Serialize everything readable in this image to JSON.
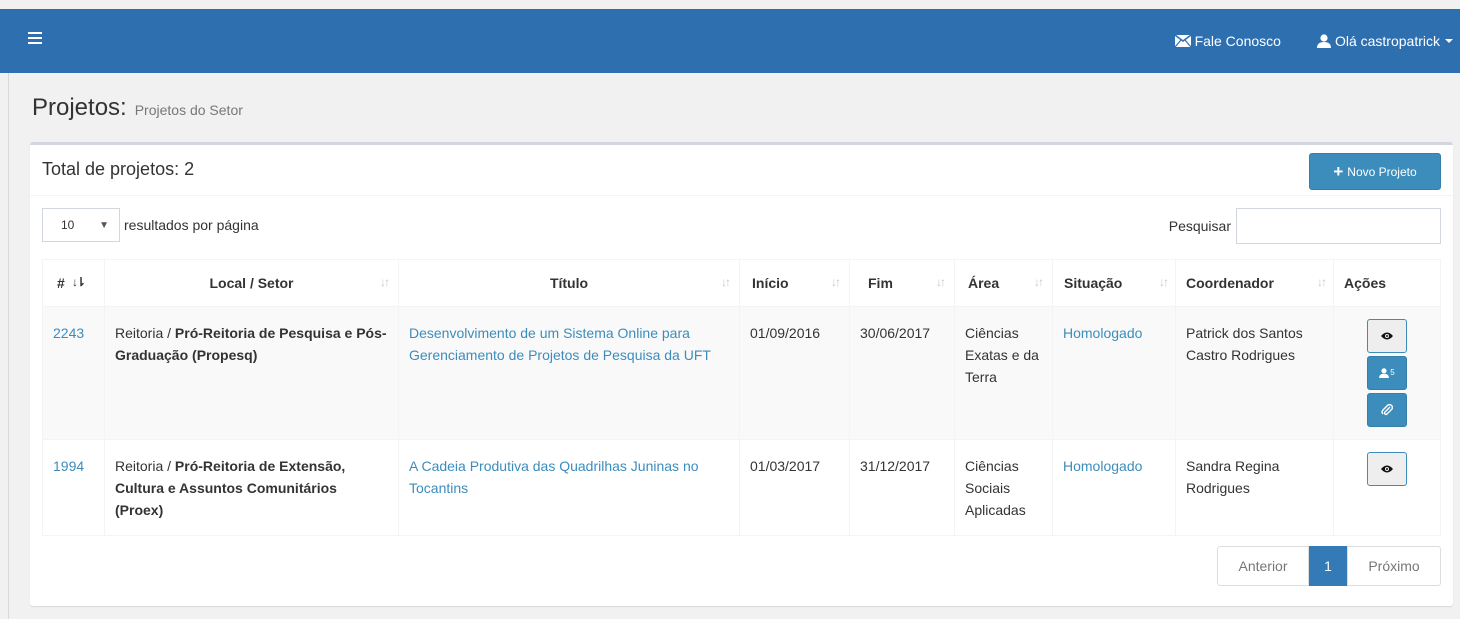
{
  "navbar": {
    "contact": "Fale Conosco",
    "user": "Olá castropatrick",
    "menu_icon": "hamburger-icon",
    "contact_icon": "envelope-icon",
    "user_icon": "user-icon",
    "color": "#2e6fb0"
  },
  "page": {
    "title": "Projetos:",
    "subtitle": "Projetos do Setor"
  },
  "box": {
    "total": "Total de projetos: 2",
    "new_button": "Novo Projeto"
  },
  "controls": {
    "page_size": "10",
    "page_size_label": "resultados por página",
    "search_label": "Pesquisar",
    "search_value": ""
  },
  "table": {
    "columns": [
      "#",
      "Local / Setor",
      "Título",
      "Início",
      "Fim",
      "Área",
      "Situação",
      "Coordenador",
      "Ações"
    ],
    "rows": [
      {
        "id": "2243",
        "local_prefix": "Reitoria / ",
        "local_bold": "Pró-Reitoria de Pesquisa e Pós-Graduação (Propesq)",
        "title": "Desenvolvimento de um Sistema Online para Gerenciamento de Projetos de Pesquisa da UFT",
        "start": "01/09/2016",
        "end": "30/06/2017",
        "area": "Ciências Exatas e da Terra",
        "status": "Homologado",
        "coordinator": "Patrick dos Santos Castro Rodrigues",
        "members_count": "5"
      },
      {
        "id": "1994",
        "local_prefix": "Reitoria / ",
        "local_bold": "Pró-Reitoria de Extensão, Cultura e Assuntos Comunitários (Proex)",
        "title": "A Cadeia Produtiva das Quadrilhas Juninas no Tocantins",
        "start": "01/03/2017",
        "end": "31/12/2017",
        "area": "Ciências Sociais Aplicadas",
        "status": "Homologado",
        "coordinator": "Sandra Regina Rodrigues"
      }
    ]
  },
  "pagination": {
    "prev": "Anterior",
    "current": "1",
    "next": "Próximo"
  }
}
